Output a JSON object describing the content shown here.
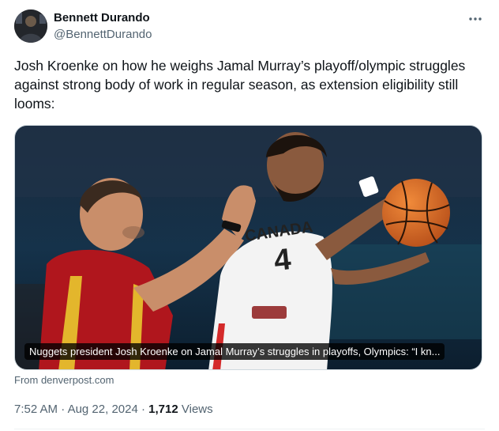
{
  "author": {
    "name": "Bennett Durando",
    "handle": "@BennettDurando"
  },
  "tweet": {
    "text": "Josh Kroenke on how he weighs Jamal Murray’s playoff/olympic struggles against strong body of work in regular season, as extension eligibility still looms:"
  },
  "card": {
    "caption": "Nuggets president Josh Kroenke on Jamal Murray’s struggles in playoffs, Olympics: “I kn...",
    "source": "From denverpost.com",
    "image": {
      "jersey_text": "CANADA",
      "jersey_number": "4"
    }
  },
  "meta": {
    "time": "7:52 AM",
    "separator": "·",
    "date": "Aug 22, 2024",
    "views_count": "1,712",
    "views_label": "Views"
  },
  "icons": {
    "more": "more-horizontal-icon"
  }
}
